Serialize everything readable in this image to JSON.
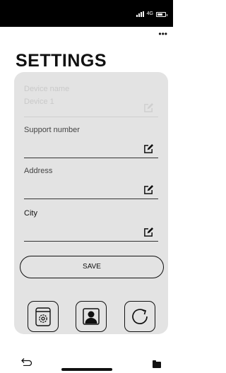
{
  "status_bar": {
    "network": "4G",
    "battery_level": 0.7
  },
  "header": {
    "title": "SETTINGS",
    "more_icon": "more-icon"
  },
  "fields": [
    {
      "label": "Device name",
      "value": "Device 1",
      "enabled": false
    },
    {
      "label": "Support number",
      "value": "",
      "enabled": true
    },
    {
      "label": "Address",
      "value": "",
      "enabled": true
    },
    {
      "label": "City",
      "value": "",
      "enabled": true
    }
  ],
  "save_button": {
    "label": "SAVE"
  },
  "actions": [
    {
      "icon": "settings-icon"
    },
    {
      "icon": "profile-icon"
    },
    {
      "icon": "refresh-icon"
    }
  ],
  "nav": {
    "back_icon": "back-icon",
    "folder_icon": "folder-icon"
  }
}
